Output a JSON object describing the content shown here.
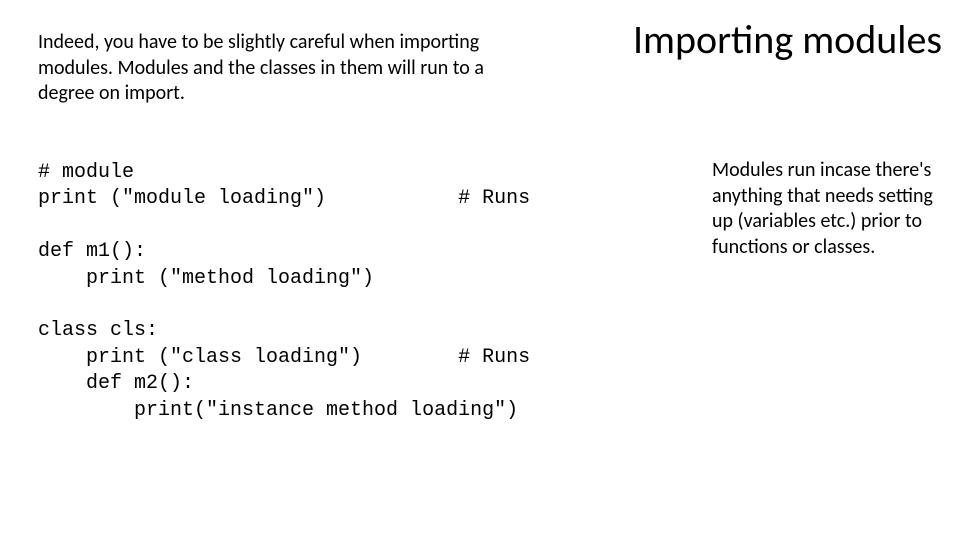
{
  "title": "Importing modules",
  "intro": "Indeed, you have to be slightly careful when importing modules. Modules and the classes in them will run to a degree on import.",
  "sidenote": "Modules run incase there's anything that needs setting up (variables etc.) prior to functions or classes.",
  "code": "# module\nprint (\"module loading\")           # Runs\n\ndef m1():\n    print (\"method loading\")\n\nclass cls:\n    print (\"class loading\")        # Runs\n    def m2():\n        print(\"instance method loading\")"
}
